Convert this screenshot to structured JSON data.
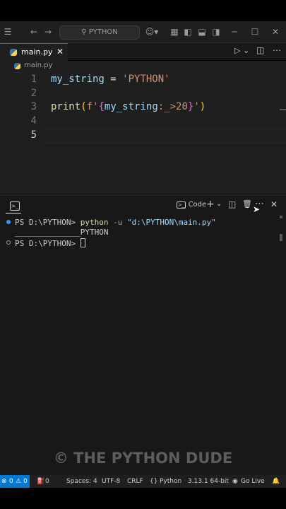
{
  "titlebar": {
    "search_text": "PYTHON"
  },
  "tab": {
    "filename": "main.py",
    "close_glyph": "✕"
  },
  "breadcrumb": {
    "file": "main.py"
  },
  "editor": {
    "line_numbers": [
      "1",
      "2",
      "3",
      "4",
      "5"
    ],
    "line1": {
      "var": "my_string",
      "op": " = ",
      "str": "'PYTHON'"
    },
    "line3": {
      "fn": "print",
      "open": "(",
      "prefix": "f'",
      "brace_open": "{",
      "var": "my_string",
      "spec": ":_>20",
      "brace_close": "}",
      "quote": "'",
      "close": ")"
    }
  },
  "panel": {
    "launch_label": "Code",
    "terminal": {
      "prompt1": "PS D:\\PYTHON> ",
      "cmd": "python",
      "flag": " -u ",
      "path": "\"d:\\PYTHON\\main.py\"",
      "output": "______________PYTHON",
      "prompt2": "PS D:\\PYTHON> "
    }
  },
  "watermark": {
    "text": "© THE PYTHON DUDE"
  },
  "statusbar": {
    "errors": "0",
    "warnings": "0",
    "ports": "0",
    "spaces": "Spaces: 4",
    "encoding": "UTF-8",
    "eol": "CRLF",
    "language": "Python",
    "interpreter": "3.13.1 64-bit",
    "golive": "Go Live"
  },
  "colors": {
    "accent": "#0078d4",
    "editor_bg": "#1f1f1f",
    "panel_bg": "#181818",
    "string": "#ce9178",
    "variable": "#9cdcfe",
    "function": "#dcdcaa"
  }
}
